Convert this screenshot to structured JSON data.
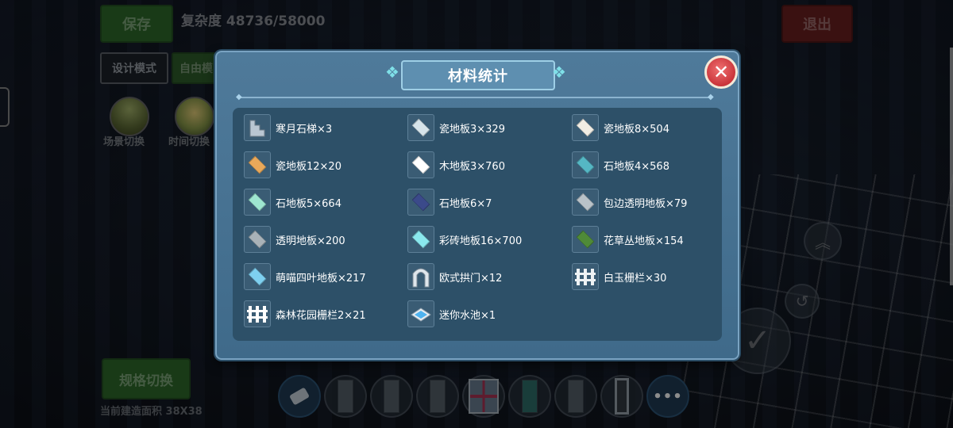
{
  "hud": {
    "save": "保存",
    "complexity": "复杂度 48736/58000",
    "exit": "退出",
    "design_mode": "设计模式",
    "free_mode": "自由模",
    "scene_switch": "场景切换",
    "time_switch": "时间切换",
    "spec_switch": "规格切换",
    "build_area": "当前建造面积 38X38"
  },
  "modal": {
    "title": "材料统计",
    "close_icon": "close-x",
    "items": [
      {
        "label": "寒月石梯×3",
        "icon": "stairs",
        "color": "#b9c6d2"
      },
      {
        "label": "瓷地板3×329",
        "icon": "tile",
        "color": "#d7e4ea"
      },
      {
        "label": "瓷地板8×504",
        "icon": "tile",
        "color": "#f1ede4"
      },
      {
        "label": "瓷地板12×20",
        "icon": "tile",
        "color": "#e8a85a"
      },
      {
        "label": "木地板3×760",
        "icon": "tile",
        "color": "#ffffff"
      },
      {
        "label": "石地板4×568",
        "icon": "tile",
        "color": "#55b7c4"
      },
      {
        "label": "石地板5×664",
        "icon": "tile",
        "color": "#9ee6d0"
      },
      {
        "label": "石地板6×7",
        "icon": "tile",
        "color": "#3b4a8a"
      },
      {
        "label": "包边透明地板×79",
        "icon": "tile",
        "color": "#b9c2c8"
      },
      {
        "label": "透明地板×200",
        "icon": "tile",
        "color": "#a9b2b8"
      },
      {
        "label": "彩砖地板16×700",
        "icon": "tile",
        "color": "#8ae8ee"
      },
      {
        "label": "花草丛地板×154",
        "icon": "tile",
        "color": "#4f8a38"
      },
      {
        "label": "萌喵四叶地板×217",
        "icon": "tile",
        "color": "#7ed0f0"
      },
      {
        "label": "欧式拱门×12",
        "icon": "arch",
        "color": "#dfe6ec"
      },
      {
        "label": "白玉栅栏×30",
        "icon": "fence",
        "color": "#eef2f4"
      },
      {
        "label": "森林花园栅栏2×21",
        "icon": "fence",
        "color": "#ffffff"
      },
      {
        "label": "迷你水池×1",
        "icon": "pool",
        "color": "#4fb3f0"
      }
    ]
  }
}
